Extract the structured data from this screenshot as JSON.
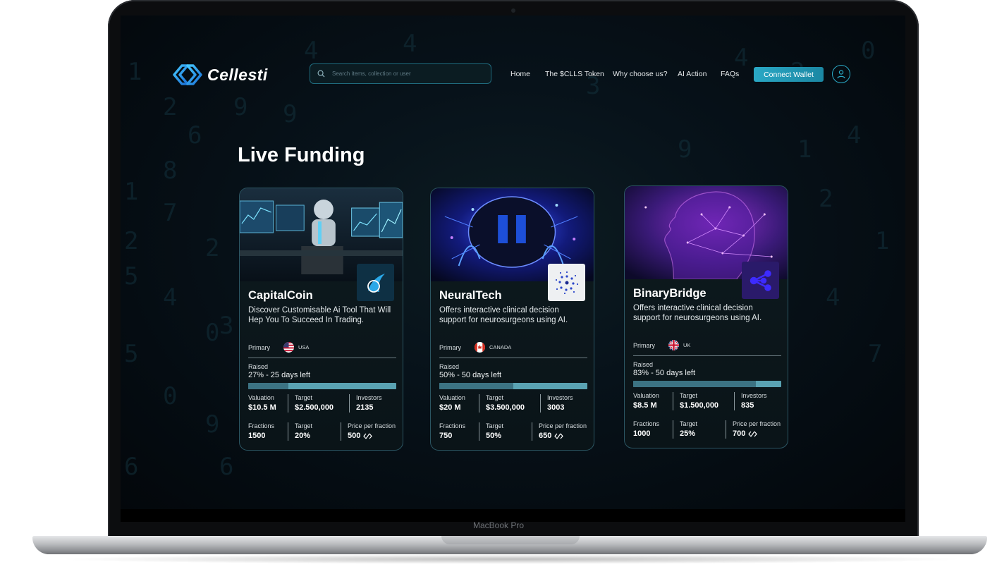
{
  "device": {
    "model_label": "MacBook Pro"
  },
  "app": {
    "brand": "Cellesti",
    "search": {
      "placeholder": "Search items, collection or user"
    },
    "nav": [
      "Home",
      "The $CLLS Token",
      "Why choose us?",
      "AI Action",
      "FAQs"
    ],
    "connect_label": "Connect Wallet",
    "accent": "#2aa8c5"
  },
  "section_title": "Live Funding",
  "cards": [
    {
      "name": "CapitalCoin",
      "description": "Discover Customisable Ai Tool That Will Hep You To Succeed In Trading.",
      "primary_label": "Primary",
      "country": "USA",
      "raised_label": "Raised",
      "raised_text": "27% - 25 days left",
      "raised_fraction": 0.27,
      "valuation_label": "Valuation",
      "valuation": "$10.5 M",
      "target_label": "Target",
      "target": "$2.500,000",
      "investors_label": "Investors",
      "investors": "2135",
      "fractions_label": "Fractions",
      "fractions": "1500",
      "target_pct_label": "Target",
      "target_pct": "20%",
      "price_label": "Price per fraction",
      "price": "500",
      "logo_icon": "sail-icon"
    },
    {
      "name": "NeuralTech",
      "description": "Offers interactive clinical decision support for neurosurgeons using AI.",
      "primary_label": "Primary",
      "country": "CANADA",
      "raised_label": "Raised",
      "raised_text": "50% - 50 days left",
      "raised_fraction": 0.5,
      "valuation_label": "Valuation",
      "valuation": "$20 M",
      "target_label": "Target",
      "target": "$3.500,000",
      "investors_label": "Investors",
      "investors": "3003",
      "fractions_label": "Fractions",
      "fractions": "750",
      "target_pct_label": "Target",
      "target_pct": "50%",
      "price_label": "Price per fraction",
      "price": "650",
      "logo_icon": "spiral-dots-icon"
    },
    {
      "name": "BinaryBridge",
      "description": "Offers interactive clinical decision support for neurosurgeons using AI.",
      "primary_label": "Primary",
      "country": "UK",
      "raised_label": "Raised",
      "raised_text": "83% - 50 days left",
      "raised_fraction": 0.83,
      "valuation_label": "Valuation",
      "valuation": "$8.5 M",
      "target_label": "Target",
      "target": "$1.500,000",
      "investors_label": "Investors",
      "investors": "835",
      "fractions_label": "Fractions",
      "fractions": "1000",
      "target_pct_label": "Target",
      "target_pct": "25%",
      "price_label": "Price per fraction",
      "price": "700",
      "logo_icon": "network-nodes-icon"
    }
  ]
}
